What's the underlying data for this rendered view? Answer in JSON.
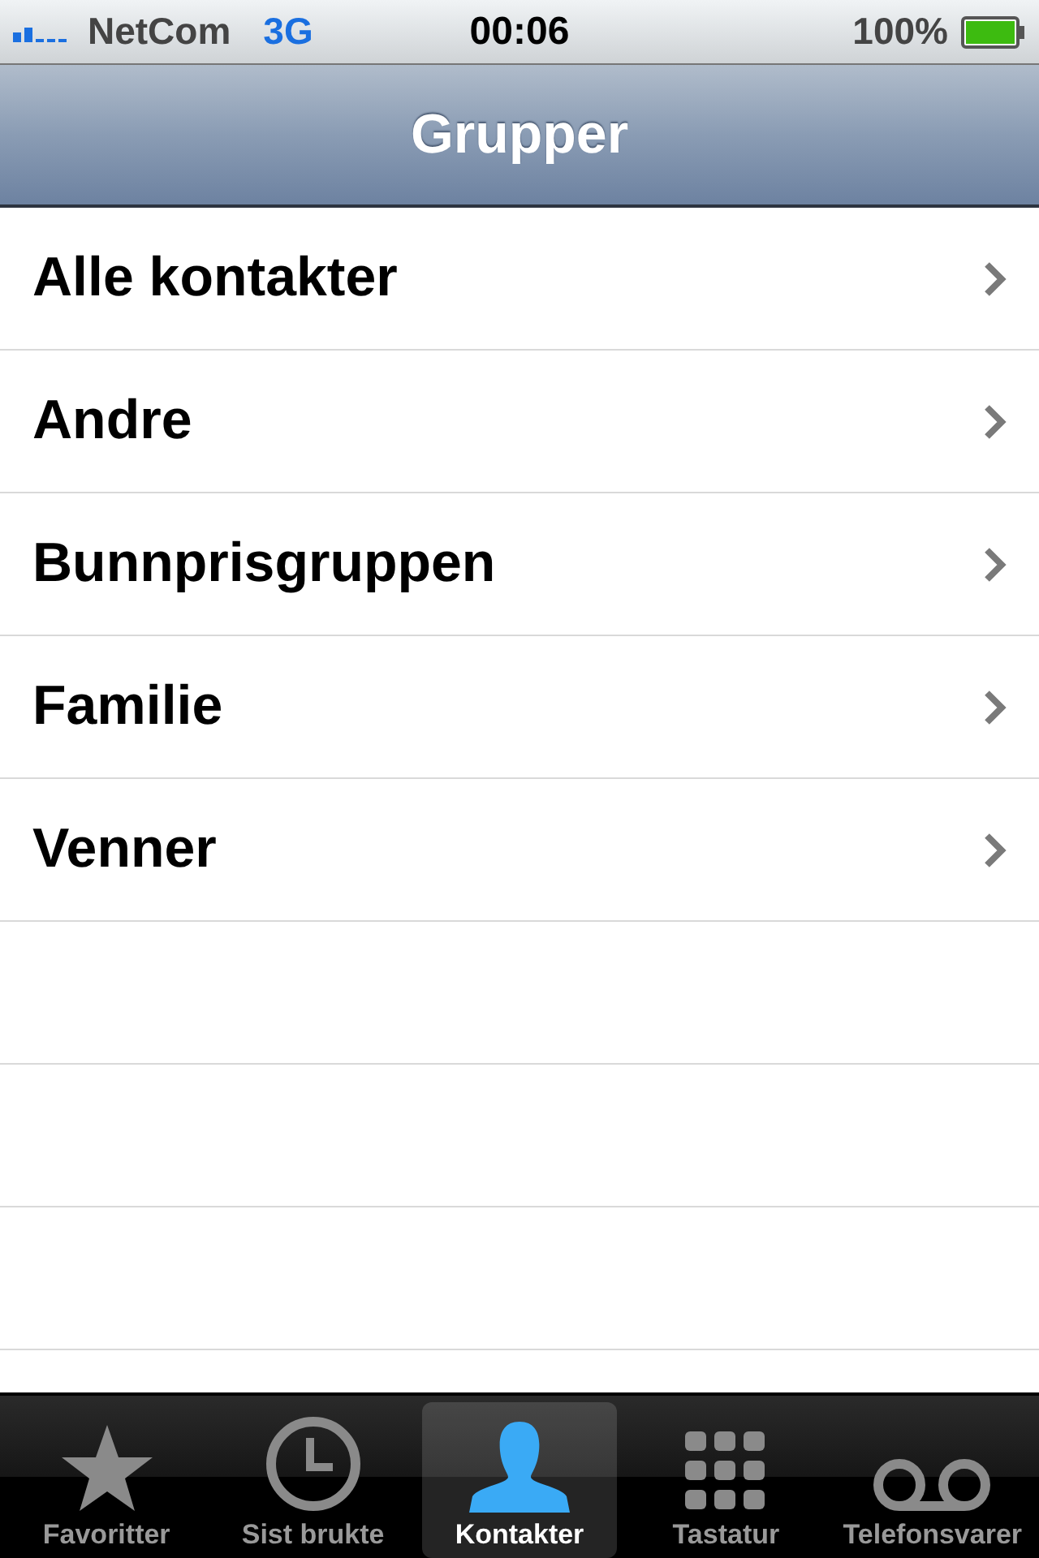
{
  "status_bar": {
    "carrier": "NetCom",
    "network": "3G",
    "time": "00:06",
    "battery": "100%"
  },
  "nav_bar": {
    "title": "Grupper"
  },
  "groups": [
    {
      "label": "Alle kontakter"
    },
    {
      "label": "Andre"
    },
    {
      "label": "Bunnprisgruppen"
    },
    {
      "label": "Familie"
    },
    {
      "label": "Venner"
    }
  ],
  "tab_bar": [
    {
      "label": "Favoritter",
      "kind": "star",
      "selected": false
    },
    {
      "label": "Sist brukte",
      "kind": "clock",
      "selected": false
    },
    {
      "label": "Kontakter",
      "kind": "person",
      "selected": true
    },
    {
      "label": "Tastatur",
      "kind": "keypad",
      "selected": false
    },
    {
      "label": "Telefonsvarer",
      "kind": "voicemail",
      "selected": false
    }
  ]
}
